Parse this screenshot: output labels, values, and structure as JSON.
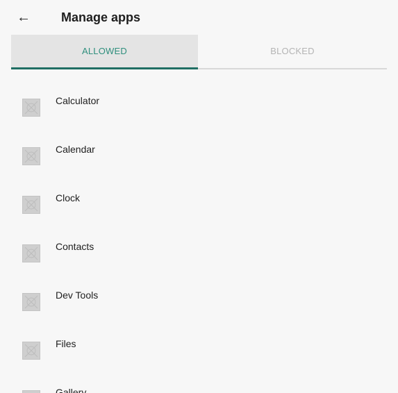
{
  "header": {
    "back_icon": "arrow-back-icon",
    "back_glyph": "←",
    "title": "Manage apps"
  },
  "tabs": [
    {
      "label": "ALLOWED",
      "selected": true
    },
    {
      "label": "BLOCKED",
      "selected": false
    }
  ],
  "colors": {
    "active_tab_text": "#2f8f7d",
    "active_tab_indicator": "#1f6e63",
    "inactive_tab_text": "#b4b4b4"
  },
  "apps": [
    {
      "name": "Calculator",
      "icon": "app-placeholder-icon"
    },
    {
      "name": "Calendar",
      "icon": "app-placeholder-icon"
    },
    {
      "name": "Clock",
      "icon": "app-placeholder-icon"
    },
    {
      "name": "Contacts",
      "icon": "app-placeholder-icon"
    },
    {
      "name": "Dev Tools",
      "icon": "app-placeholder-icon"
    },
    {
      "name": "Files",
      "icon": "app-placeholder-icon"
    },
    {
      "name": "Gallery",
      "icon": "app-placeholder-icon"
    }
  ]
}
